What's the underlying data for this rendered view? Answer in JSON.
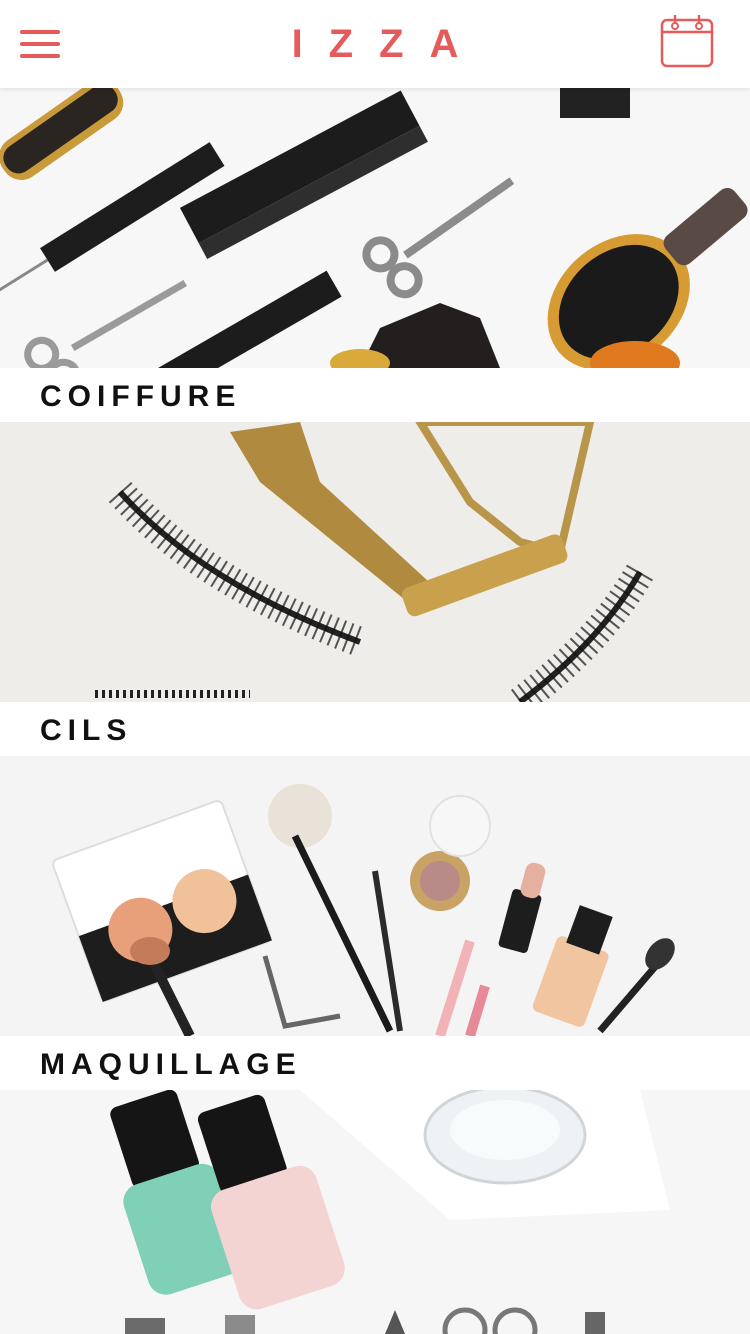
{
  "header": {
    "logo": "IZZA",
    "menu_icon": "hamburger-menu-icon",
    "calendar_icon": "calendar-icon",
    "accent_color": "#e55b5b"
  },
  "categories": [
    {
      "label": "COIFFURE",
      "image": "hair-tools-photo"
    },
    {
      "label": "CILS",
      "image": "eyelashes-photo"
    },
    {
      "label": "MAQUILLAGE",
      "image": "makeup-photo"
    },
    {
      "label": "",
      "image": "nail-polish-photo"
    }
  ]
}
